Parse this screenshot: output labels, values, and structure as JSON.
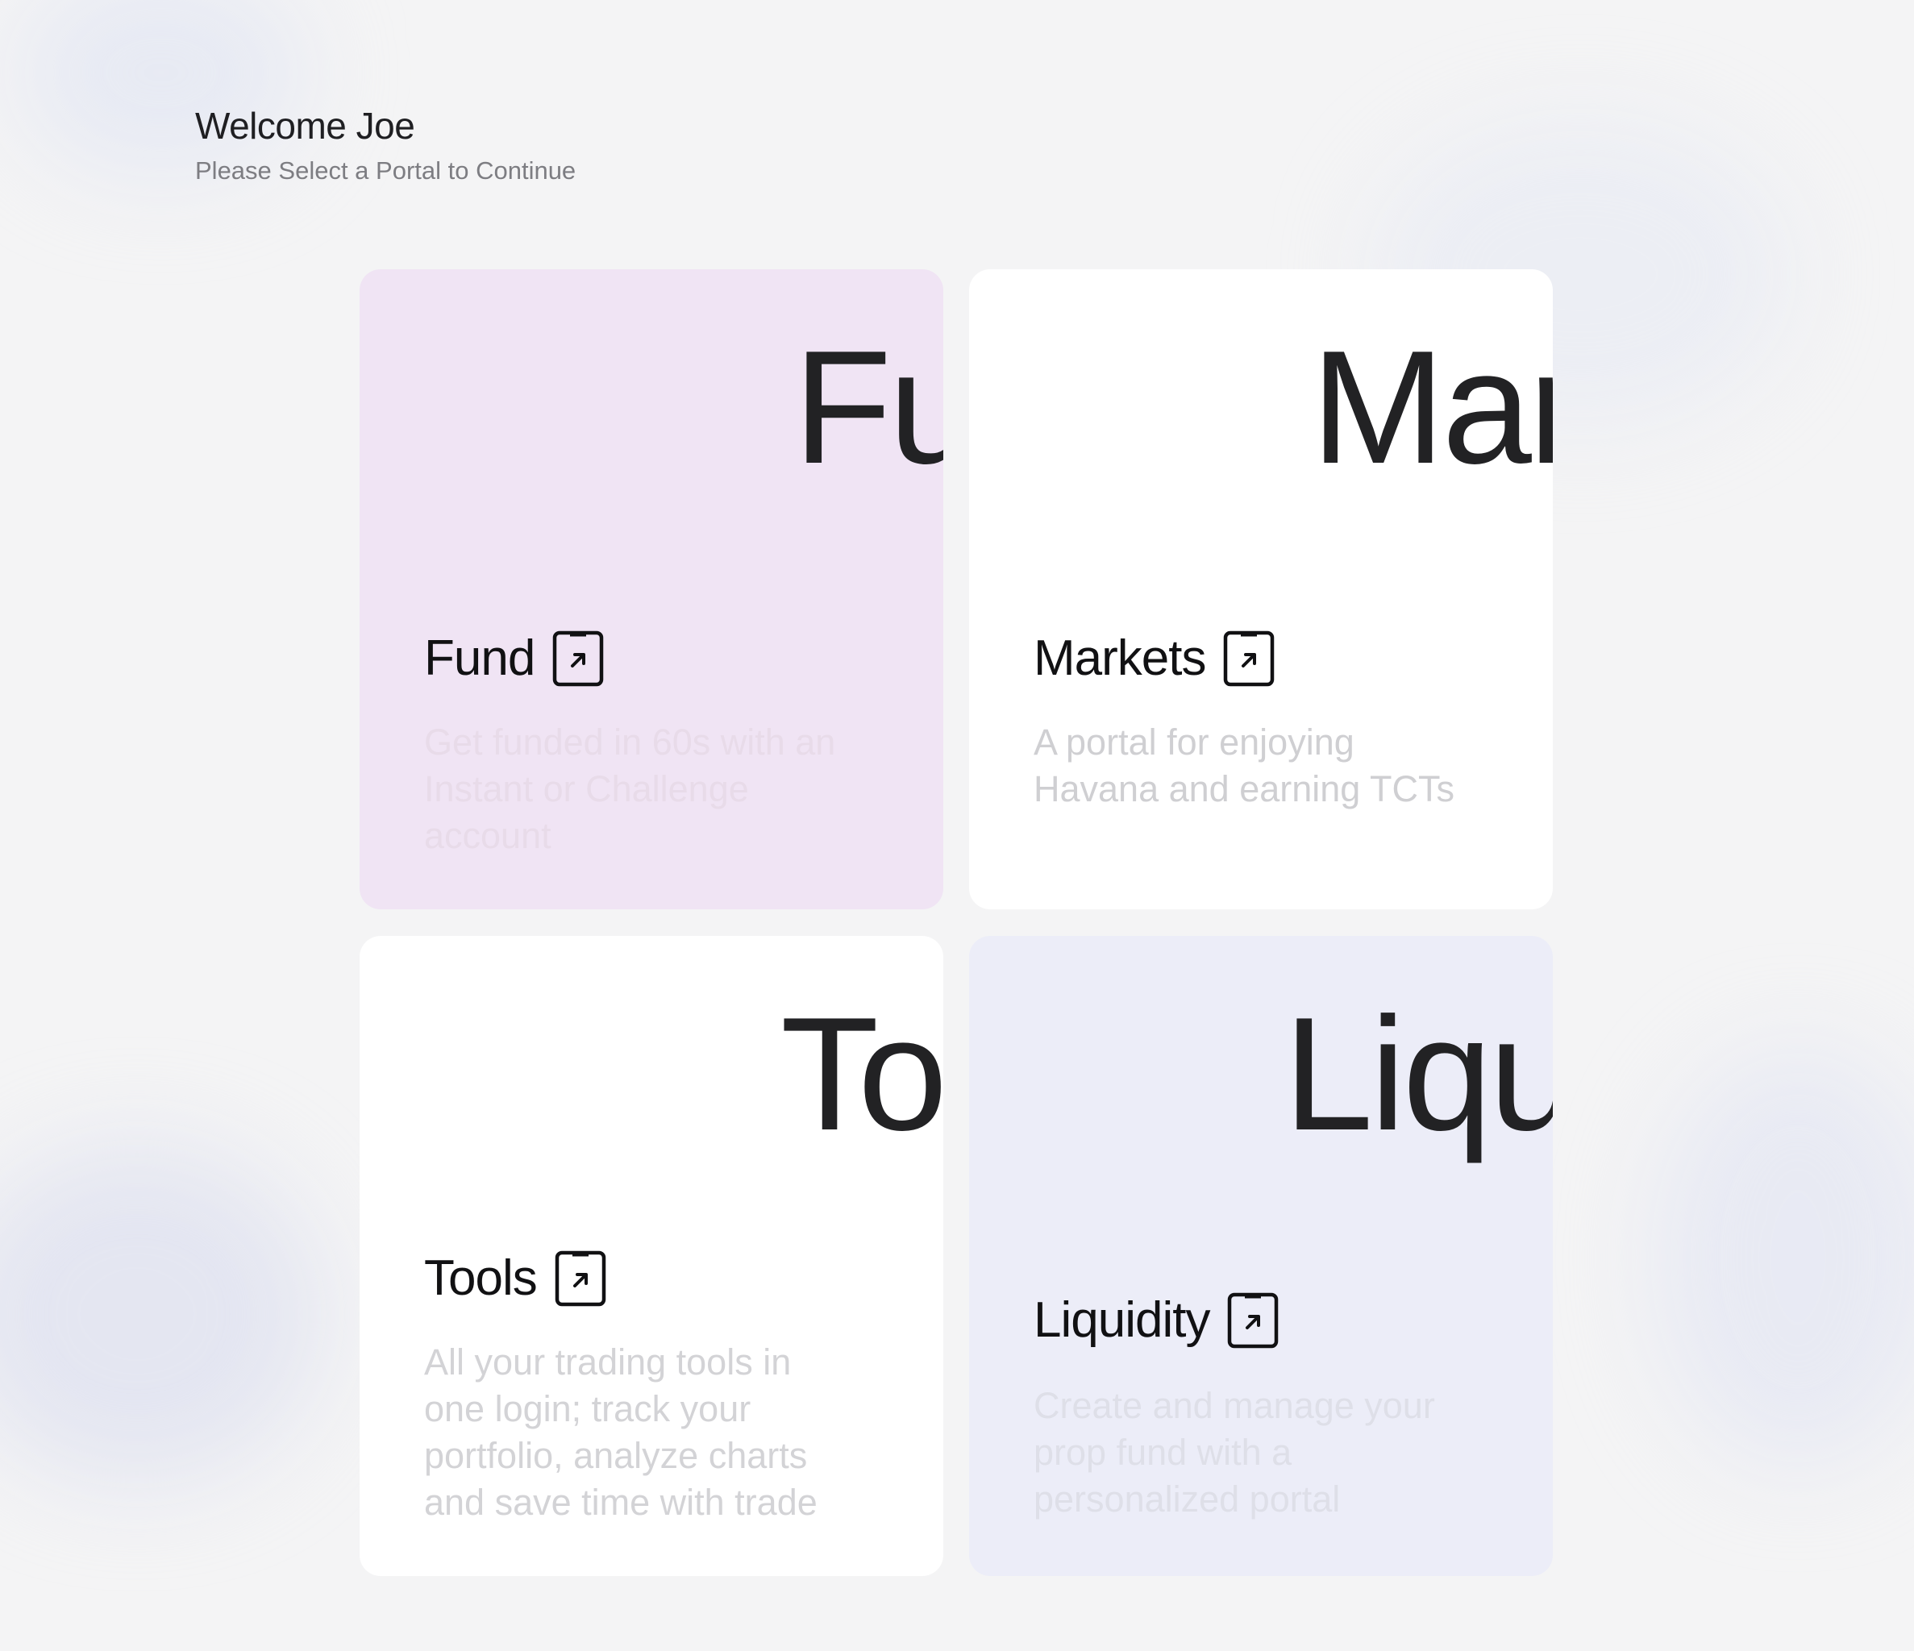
{
  "header": {
    "title": "Welcome Joe",
    "subtitle": "Please Select a Portal to Continue"
  },
  "portals": [
    {
      "key": "fund",
      "big_word": "Fu",
      "title": "Fund",
      "description": "Get funded in 60s with an Instant or Challenge account",
      "background": "#f0e4f4",
      "icon": "external-link-icon"
    },
    {
      "key": "markets",
      "big_word": "Mar",
      "title": "Markets",
      "description": "A portal for enjoying Havana and earning TCTs",
      "background": "#ffffff",
      "icon": "external-link-icon"
    },
    {
      "key": "tools",
      "big_word": "To",
      "title": "Tools",
      "description": "All your trading tools in one login; track your portfolio, analyze charts and save time with trade",
      "background": "#ffffff",
      "icon": "external-link-icon"
    },
    {
      "key": "liquidity",
      "big_word": "Liqu",
      "title": "Liquidity",
      "description": "Create and manage your prop fund with a personalized portal",
      "background": "#ecedf8",
      "icon": "external-link-icon"
    }
  ]
}
